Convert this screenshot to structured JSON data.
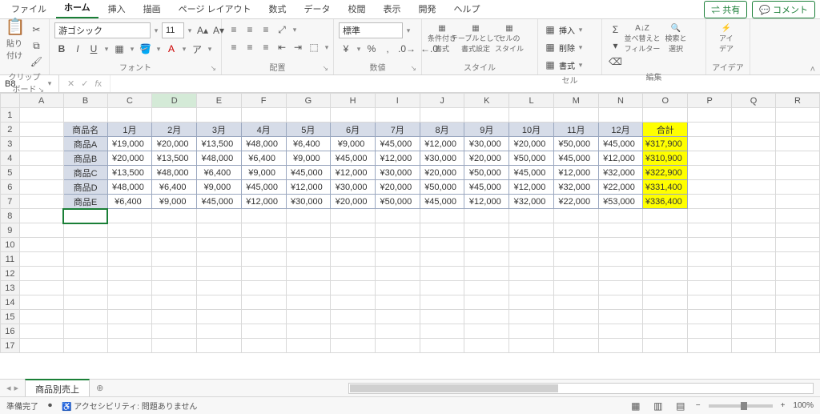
{
  "tabs": [
    "ファイル",
    "ホーム",
    "挿入",
    "描画",
    "ページ レイアウト",
    "数式",
    "データ",
    "校閲",
    "表示",
    "開発",
    "ヘルプ"
  ],
  "active_tab": 1,
  "share": "共有",
  "comment": "コメント",
  "ribbon": {
    "clipboard": {
      "label": "クリップボード",
      "paste": "貼り付け"
    },
    "font": {
      "label": "フォント",
      "name": "游ゴシック",
      "size": "11",
      "bold": "B",
      "italic": "I",
      "underline": "U"
    },
    "align": {
      "label": "配置"
    },
    "number": {
      "label": "数値",
      "format": "標準"
    },
    "styles": {
      "label": "スタイル",
      "cond": "条件付き\n書式",
      "table": "テーブルとして\n書式設定",
      "cell": "セルの\nスタイル"
    },
    "cells": {
      "label": "セル",
      "insert": "挿入",
      "delete": "削除",
      "format": "書式"
    },
    "editing": {
      "label": "編集",
      "sort": "並べ替えと\nフィルター",
      "find": "検索と\n選択"
    },
    "ideas": {
      "label": "アイデア",
      "btn": "アイ\nデア"
    }
  },
  "namebox": "B8",
  "columns": [
    "A",
    "B",
    "C",
    "D",
    "E",
    "F",
    "G",
    "H",
    "I",
    "J",
    "K",
    "L",
    "M",
    "N",
    "O",
    "P",
    "Q",
    "R"
  ],
  "rowcount": 17,
  "selected": {
    "col": "D",
    "row": 8,
    "cursor": "B8"
  },
  "table": {
    "headers": [
      "商品名",
      "1月",
      "2月",
      "3月",
      "4月",
      "5月",
      "6月",
      "7月",
      "8月",
      "9月",
      "10月",
      "11月",
      "12月",
      "合計"
    ],
    "rows": [
      {
        "name": "商品A",
        "v": [
          "¥19,000",
          "¥20,000",
          "¥13,500",
          "¥48,000",
          "¥6,400",
          "¥9,000",
          "¥45,000",
          "¥12,000",
          "¥30,000",
          "¥20,000",
          "¥50,000",
          "¥45,000"
        ],
        "sum": "¥317,900"
      },
      {
        "name": "商品B",
        "v": [
          "¥20,000",
          "¥13,500",
          "¥48,000",
          "¥6,400",
          "¥9,000",
          "¥45,000",
          "¥12,000",
          "¥30,000",
          "¥20,000",
          "¥50,000",
          "¥45,000",
          "¥12,000"
        ],
        "sum": "¥310,900"
      },
      {
        "name": "商品C",
        "v": [
          "¥13,500",
          "¥48,000",
          "¥6,400",
          "¥9,000",
          "¥45,000",
          "¥12,000",
          "¥30,000",
          "¥20,000",
          "¥50,000",
          "¥45,000",
          "¥12,000",
          "¥32,000"
        ],
        "sum": "¥322,900"
      },
      {
        "name": "商品D",
        "v": [
          "¥48,000",
          "¥6,400",
          "¥9,000",
          "¥45,000",
          "¥12,000",
          "¥30,000",
          "¥20,000",
          "¥50,000",
          "¥45,000",
          "¥12,000",
          "¥32,000",
          "¥22,000"
        ],
        "sum": "¥331,400"
      },
      {
        "name": "商品E",
        "v": [
          "¥6,400",
          "¥9,000",
          "¥45,000",
          "¥12,000",
          "¥30,000",
          "¥20,000",
          "¥50,000",
          "¥45,000",
          "¥12,000",
          "¥32,000",
          "¥22,000",
          "¥53,000"
        ],
        "sum": "¥336,400"
      }
    ]
  },
  "sheet_tab": "商品別売上",
  "status": {
    "ready": "準備完了",
    "access": "アクセシビリティ: 問題ありません",
    "zoom": "100%"
  }
}
